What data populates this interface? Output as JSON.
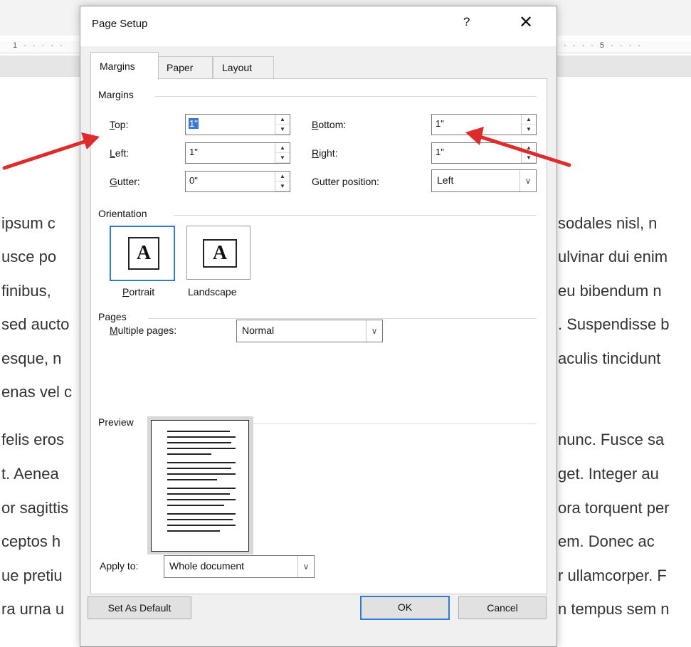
{
  "background": {
    "ruler_left": "1 · · · · ·",
    "ruler_right": "· · · · 5 · · · ·",
    "left_lines": [
      "ipsum c",
      "usce po",
      "finibus,",
      "sed aucto",
      "esque, n",
      "enas vel c",
      "felis eros",
      "t. Aenea",
      "or sagittis",
      "ceptos h",
      "ue pretiu",
      "ra urna u"
    ],
    "right_lines": [
      "sodales nisl, n",
      "ulvinar dui enim",
      "eu bibendum n",
      ". Suspendisse b",
      "aculis tincidunt",
      "",
      "nunc. Fusce sa",
      "get. Integer au",
      "ora torquent per",
      "em. Donec ac",
      "r ullamcorper. F",
      "n tempus sem n"
    ]
  },
  "dialog": {
    "title": "Page Setup",
    "help": "?",
    "close": "✕",
    "tabs": [
      {
        "label": "Margins",
        "active": true
      },
      {
        "label": "Paper",
        "active": false
      },
      {
        "label": "Layout",
        "active": false
      }
    ],
    "margins": {
      "section": "Margins",
      "top_label": "Top:",
      "top_value": "1\"",
      "bottom_label": "Bottom:",
      "bottom_value": "1\"",
      "left_label": "Left:",
      "left_value": "1\"",
      "right_label": "Right:",
      "right_value": "1\"",
      "gutter_label": "Gutter:",
      "gutter_value": "0\"",
      "gutter_position_label": "Gutter position:",
      "gutter_position_value": "Left"
    },
    "orientation": {
      "section": "Orientation",
      "portrait": "Portrait",
      "landscape": "Landscape",
      "glyph": "A"
    },
    "pages": {
      "section": "Pages",
      "multiple_label": "Multiple pages:",
      "multiple_value": "Normal"
    },
    "preview": {
      "section": "Preview"
    },
    "apply_to": {
      "label": "Apply to:",
      "value": "Whole document"
    },
    "buttons": {
      "set_default": "Set As Default",
      "ok": "OK",
      "cancel": "Cancel"
    }
  },
  "colors": {
    "accent": "#2f7ad6",
    "selection": "#3b78d8",
    "arrow": "#e02b2b"
  }
}
